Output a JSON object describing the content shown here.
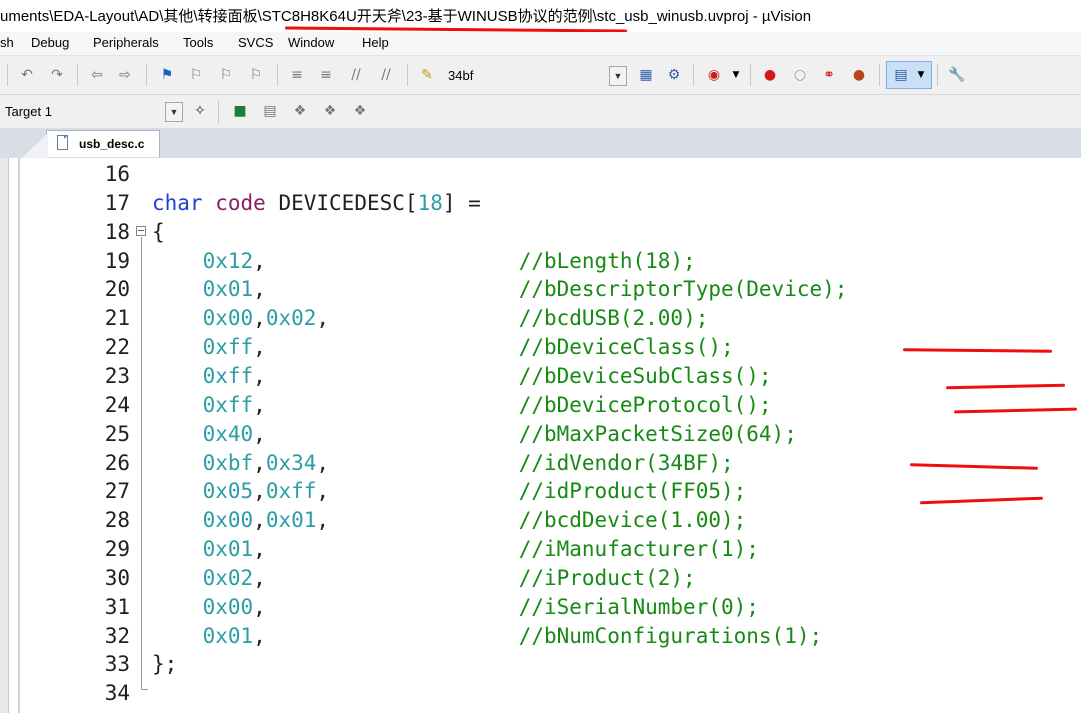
{
  "window": {
    "title": "uments\\EDA-Layout\\AD\\其他\\转接面板\\STC8H8K64U开天斧\\23-基于WINUSB协议的范例\\stc_usb_winusb.uvproj - µVision"
  },
  "menu": [
    "sh",
    "Debug",
    "Peripherals",
    "Tools",
    "SVCS",
    "Window",
    "Help"
  ],
  "toolbar": {
    "find_value": "34bf",
    "target_value": "Target 1"
  },
  "editor": {
    "tab_label": "usb_desc.c",
    "lines": [
      {
        "n": "16",
        "tokens": []
      },
      {
        "n": "17",
        "tokens": [
          [
            "kw",
            "char"
          ],
          [
            "op",
            " "
          ],
          [
            "ty",
            "code"
          ],
          [
            "op",
            " "
          ],
          [
            "id",
            "DEVICEDESC"
          ],
          [
            "op",
            "["
          ],
          [
            "num",
            "18"
          ],
          [
            "op",
            "] ="
          ]
        ]
      },
      {
        "n": "18",
        "tokens": [
          [
            "op",
            "{"
          ]
        ]
      },
      {
        "n": "19",
        "tokens": [
          [
            "op",
            "    "
          ],
          [
            "num",
            "0x12"
          ],
          [
            "op",
            ","
          ],
          [
            "op",
            "                    "
          ],
          [
            "cmt",
            "//bLength(18);"
          ]
        ]
      },
      {
        "n": "20",
        "tokens": [
          [
            "op",
            "    "
          ],
          [
            "num",
            "0x01"
          ],
          [
            "op",
            ","
          ],
          [
            "op",
            "                    "
          ],
          [
            "cmt",
            "//bDescriptorType(Device);"
          ]
        ]
      },
      {
        "n": "21",
        "tokens": [
          [
            "op",
            "    "
          ],
          [
            "num",
            "0x00"
          ],
          [
            "op",
            ","
          ],
          [
            "num",
            "0x02"
          ],
          [
            "op",
            ","
          ],
          [
            "op",
            "               "
          ],
          [
            "cmt",
            "//bcdUSB(2.00);"
          ]
        ]
      },
      {
        "n": "22",
        "tokens": [
          [
            "op",
            "    "
          ],
          [
            "num",
            "0xff"
          ],
          [
            "op",
            ","
          ],
          [
            "op",
            "                    "
          ],
          [
            "cmt",
            "//bDeviceClass();"
          ]
        ]
      },
      {
        "n": "23",
        "tokens": [
          [
            "op",
            "    "
          ],
          [
            "num",
            "0xff"
          ],
          [
            "op",
            ","
          ],
          [
            "op",
            "                    "
          ],
          [
            "cmt",
            "//bDeviceSubClass();"
          ]
        ]
      },
      {
        "n": "24",
        "tokens": [
          [
            "op",
            "    "
          ],
          [
            "num",
            "0xff"
          ],
          [
            "op",
            ","
          ],
          [
            "op",
            "                    "
          ],
          [
            "cmt",
            "//bDeviceProtocol();"
          ]
        ]
      },
      {
        "n": "25",
        "tokens": [
          [
            "op",
            "    "
          ],
          [
            "num",
            "0x40"
          ],
          [
            "op",
            ","
          ],
          [
            "op",
            "                    "
          ],
          [
            "cmt",
            "//bMaxPacketSize0(64);"
          ]
        ]
      },
      {
        "n": "26",
        "tokens": [
          [
            "op",
            "    "
          ],
          [
            "num",
            "0xbf"
          ],
          [
            "op",
            ","
          ],
          [
            "num",
            "0x34"
          ],
          [
            "op",
            ","
          ],
          [
            "op",
            "               "
          ],
          [
            "cmt",
            "//idVendor(34BF);"
          ]
        ]
      },
      {
        "n": "27",
        "tokens": [
          [
            "op",
            "    "
          ],
          [
            "num",
            "0x05"
          ],
          [
            "op",
            ","
          ],
          [
            "num",
            "0xff"
          ],
          [
            "op",
            ","
          ],
          [
            "op",
            "               "
          ],
          [
            "cmt",
            "//idProduct(FF05);"
          ]
        ]
      },
      {
        "n": "28",
        "tokens": [
          [
            "op",
            "    "
          ],
          [
            "num",
            "0x00"
          ],
          [
            "op",
            ","
          ],
          [
            "num",
            "0x01"
          ],
          [
            "op",
            ","
          ],
          [
            "op",
            "               "
          ],
          [
            "cmt",
            "//bcdDevice(1.00);"
          ]
        ]
      },
      {
        "n": "29",
        "tokens": [
          [
            "op",
            "    "
          ],
          [
            "num",
            "0x01"
          ],
          [
            "op",
            ","
          ],
          [
            "op",
            "                    "
          ],
          [
            "cmt",
            "//iManufacturer(1);"
          ]
        ]
      },
      {
        "n": "30",
        "tokens": [
          [
            "op",
            "    "
          ],
          [
            "num",
            "0x02"
          ],
          [
            "op",
            ","
          ],
          [
            "op",
            "                    "
          ],
          [
            "cmt",
            "//iProduct(2);"
          ]
        ]
      },
      {
        "n": "31",
        "tokens": [
          [
            "op",
            "    "
          ],
          [
            "num",
            "0x00"
          ],
          [
            "op",
            ","
          ],
          [
            "op",
            "                    "
          ],
          [
            "cmt",
            "//iSerialNumber(0);"
          ]
        ]
      },
      {
        "n": "32",
        "tokens": [
          [
            "op",
            "    "
          ],
          [
            "num",
            "0x01"
          ],
          [
            "op",
            ","
          ],
          [
            "op",
            "                    "
          ],
          [
            "cmt",
            "//bNumConfigurations(1);"
          ]
        ]
      },
      {
        "n": "33",
        "tokens": [
          [
            "op",
            "};"
          ]
        ]
      },
      {
        "n": "34",
        "tokens": []
      }
    ]
  },
  "colors": {
    "keyword": "#1f3fd1",
    "type": "#8a1f67",
    "number": "#2a9da6",
    "comment": "#178a16",
    "annotation": "#ef0d0d"
  }
}
